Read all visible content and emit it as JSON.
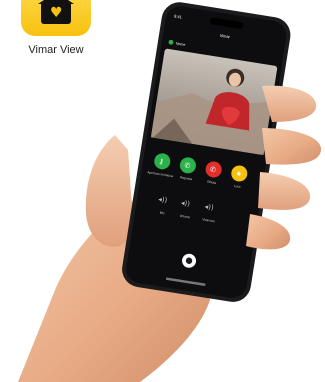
{
  "app": {
    "name": "Vimar View",
    "icon": "vimar-view-app-icon",
    "accent": "#f6c20f"
  },
  "call_screen": {
    "status_time": "9:41",
    "header_title": "Vimar",
    "caller_name": "Nome",
    "actions": [
      {
        "label": "Apertura serratura",
        "icon": "key-icon",
        "color": "#2bb24c"
      },
      {
        "label": "Risposta",
        "icon": "phone-answer-icon",
        "color": "#2bb24c"
      },
      {
        "label": "Rifiuta",
        "icon": "phone-hangup-icon",
        "color": "#e0302d"
      },
      {
        "label": "Luce",
        "icon": "bulb-icon",
        "color": "#f6c20f"
      }
    ],
    "audio_controls": [
      {
        "label": "Mic",
        "icon": "mic-icon"
      },
      {
        "label": "Volume",
        "icon": "speaker-icon"
      },
      {
        "label": "Vivavoce",
        "icon": "speaker-icon"
      }
    ],
    "home_button_icon": "home-icon"
  }
}
